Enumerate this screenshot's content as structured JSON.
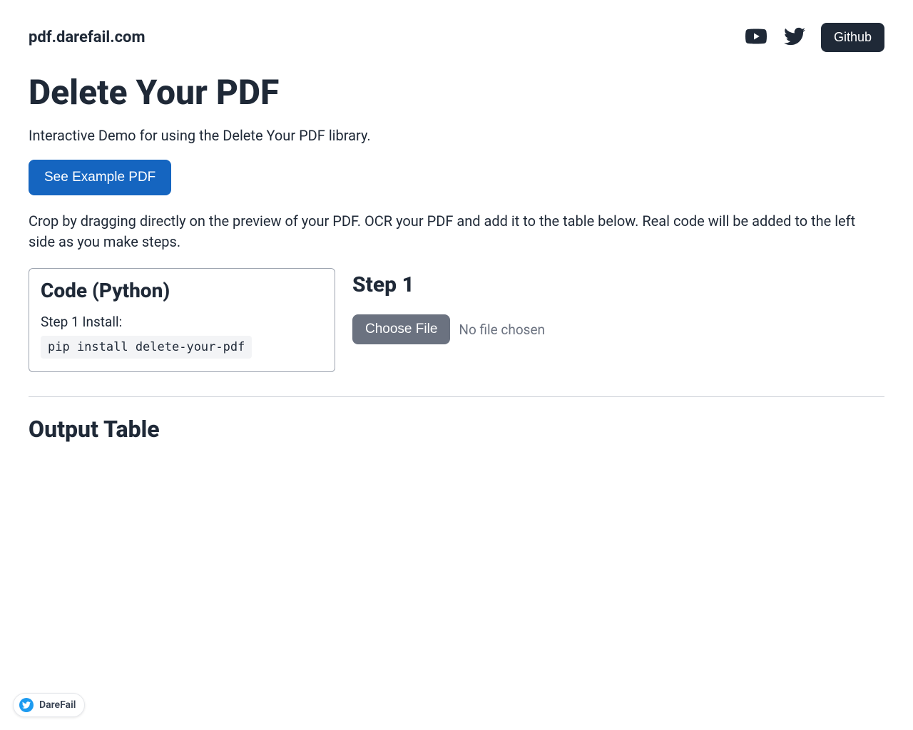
{
  "header": {
    "brand": "pdf.darefail.com",
    "github_label": "Github"
  },
  "main": {
    "title": "Delete Your PDF",
    "subtitle": "Interactive Demo for using the Delete Your PDF library.",
    "example_button": "See Example PDF",
    "description": "Crop by dragging directly on the preview of your PDF. OCR your PDF and add it to the table below. Real code will be added to the left side as you make steps."
  },
  "code_panel": {
    "title": "Code (Python)",
    "step_label": "Step 1 Install:",
    "snippet": "pip install delete-your-pdf"
  },
  "step_panel": {
    "title": "Step 1",
    "choose_file_label": "Choose File",
    "file_status": "No file chosen"
  },
  "output": {
    "title": "Output Table"
  },
  "badge": {
    "text": "DareFail"
  }
}
